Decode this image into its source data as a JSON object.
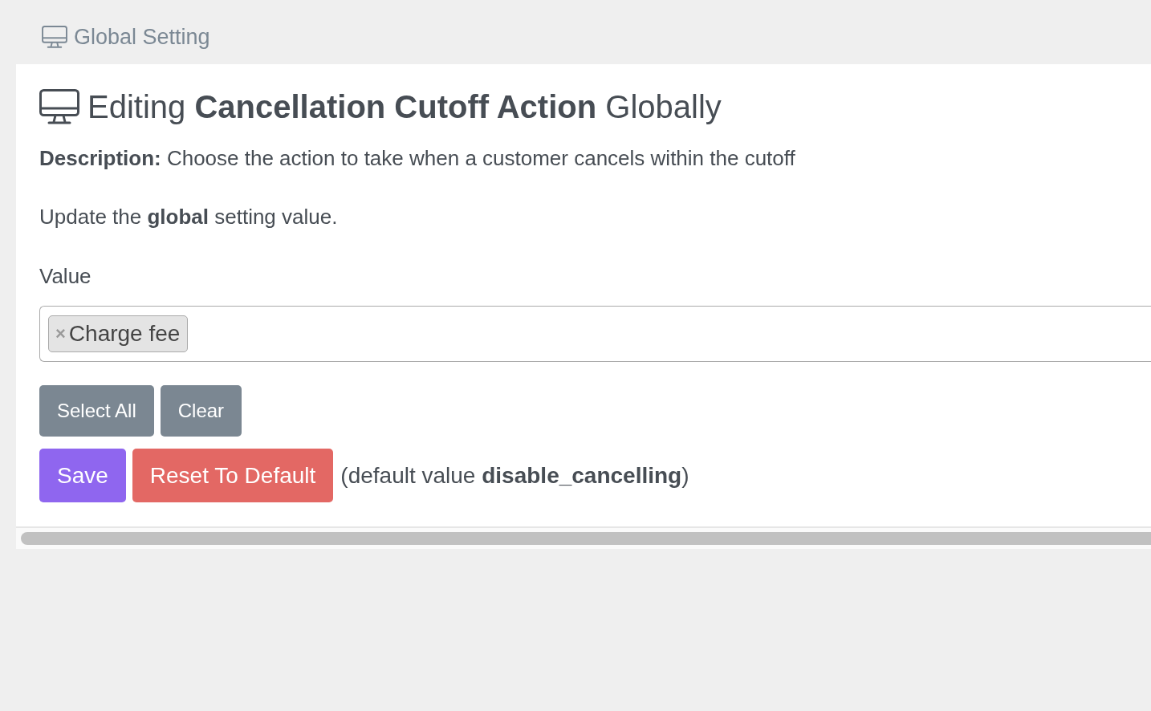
{
  "breadcrumb": {
    "title": "Global Setting"
  },
  "heading": {
    "title": "Editing **Cancellation Cutoff Action** Globally"
  },
  "description": "**Description:** Choose the action to take when a customer cancels within the cutoff",
  "instruction": "Update the **global** setting value.",
  "field": {
    "label": "Value",
    "tags": [
      {
        "label": "Charge fee",
        "remove": "×"
      }
    ]
  },
  "selection_buttons": [
    {
      "label": "Select All",
      "kind": "secondary"
    },
    {
      "label": "Clear",
      "kind": "secondary"
    }
  ],
  "actions": [
    {
      "label": "Save",
      "kind": "primary"
    },
    {
      "label": "Reset To Default",
      "kind": "danger"
    }
  ],
  "default_note": "(default value **disable_cancelling**)"
}
